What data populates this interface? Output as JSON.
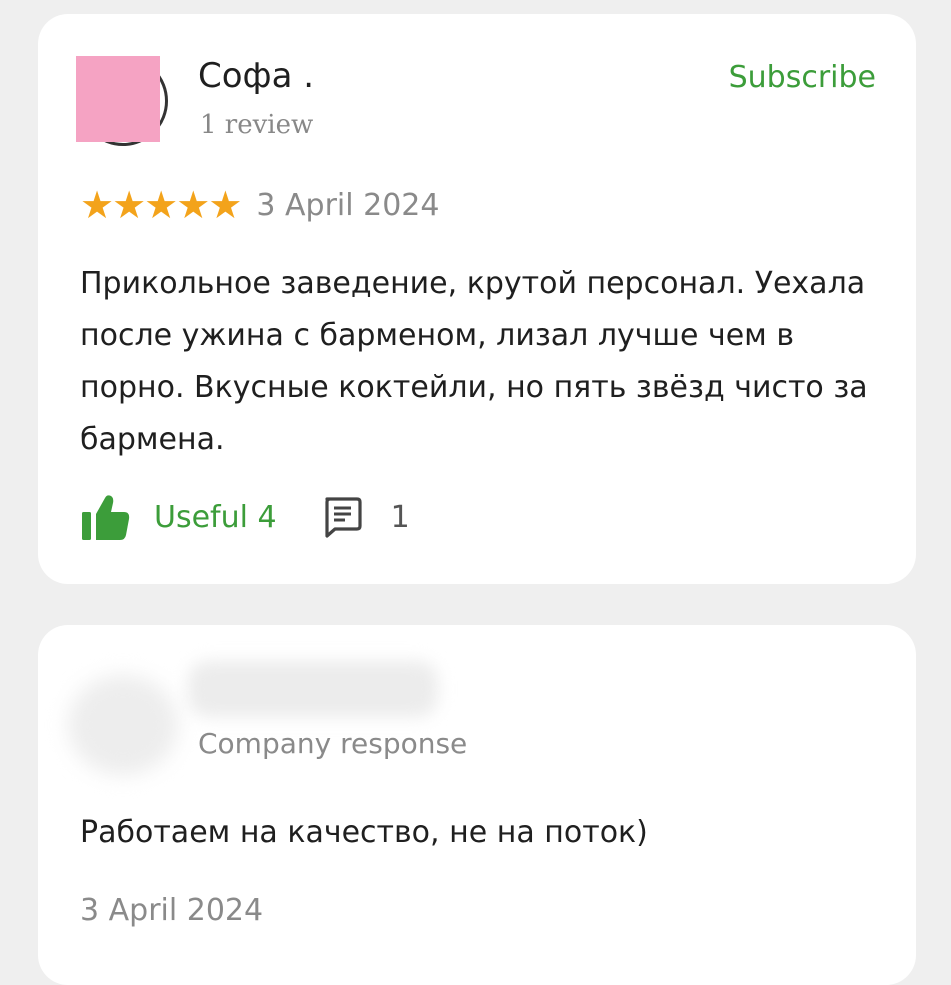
{
  "review": {
    "author_name": "Софа .",
    "author_meta": "1 review",
    "subscribe_label": "Subscribe",
    "rating": 5,
    "rating_max": 5,
    "star_glyph": "★",
    "date": "3 April 2024",
    "text": "Прикольное заведение, крутой персонал. Уехала после ужина с барменом, лизал лучше чем в порно. Вкусные коктейли, но пять звёзд чисто за бармена.",
    "useful_label": "Useful 4",
    "comment_count": "1",
    "icons": {
      "useful": "thumbs-up-icon",
      "comment": "comment-icon"
    }
  },
  "response": {
    "label": "Company response",
    "text": "Работаем на качество, не на поток)",
    "date": "3 April 2024"
  },
  "colors": {
    "background": "#efefef",
    "card": "#ffffff",
    "accent_green": "#3c9d3a",
    "star_orange": "#f3a31b",
    "muted_text": "#8a8a8a",
    "avatar_censor": "#f5a3c3"
  }
}
